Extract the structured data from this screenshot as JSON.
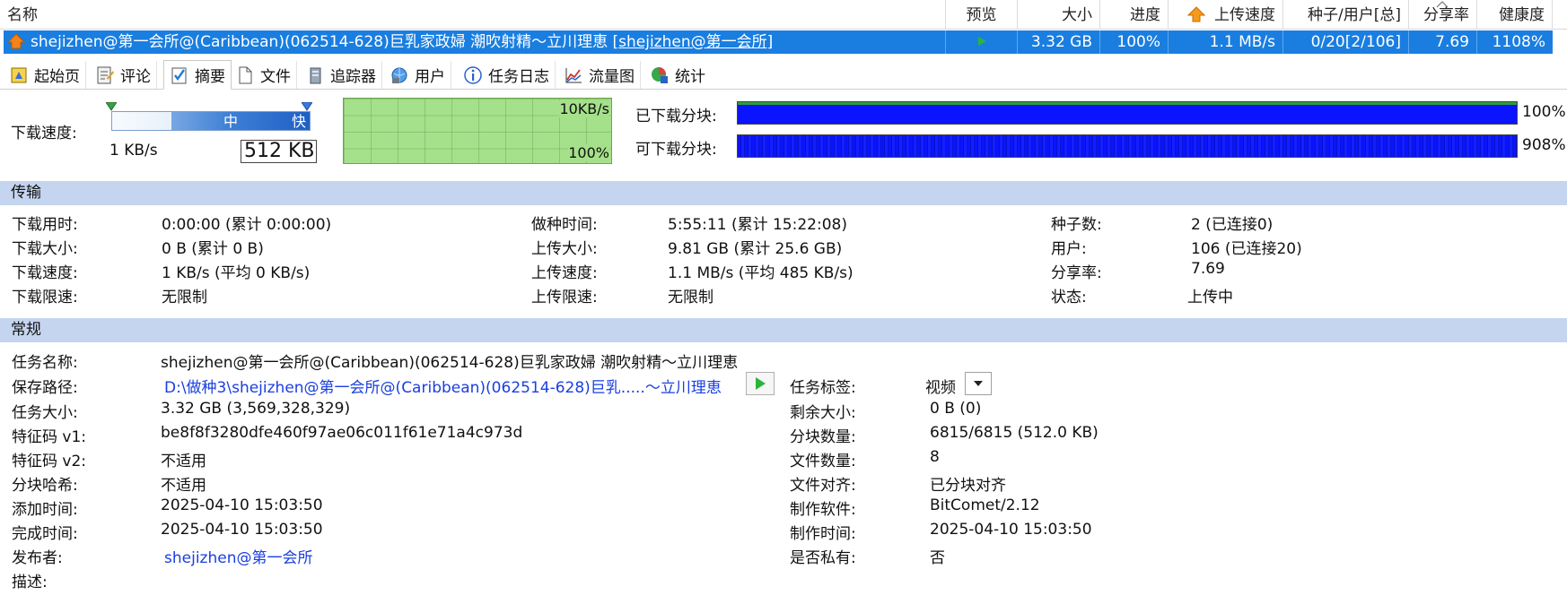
{
  "list": {
    "columns": {
      "name": "名称",
      "preview": "预览",
      "size": "大小",
      "progress": "进度",
      "upload_speed": "上传速度",
      "seeds_peers": "种子/用户[总]",
      "ratio": "分享率",
      "health": "健康度"
    },
    "row": {
      "name_prefix": "shejizhen@第一会所@(Caribbean)(062514-628)巨乳家政婦 潮吹射精～立川理恵 ",
      "name_link": "[shejizhen@第一会所]",
      "size": "3.32 GB",
      "progress": "100%",
      "upload_speed": "1.1 MB/s",
      "seeds_peers": "0/20[2/106]",
      "ratio": "7.69",
      "health": "1108%"
    }
  },
  "tabs": [
    {
      "label": "起始页",
      "icon": "start-page-icon"
    },
    {
      "label": "评论",
      "icon": "comment-icon"
    },
    {
      "label": "摘要",
      "icon": "summary-icon"
    },
    {
      "label": "文件",
      "icon": "file-icon"
    },
    {
      "label": "追踪器",
      "icon": "tracker-icon"
    },
    {
      "label": "用户",
      "icon": "users-icon"
    },
    {
      "label": "任务日志",
      "icon": "info-icon"
    },
    {
      "label": "流量图",
      "icon": "traffic-chart-icon"
    },
    {
      "label": "统计",
      "icon": "statistics-icon"
    }
  ],
  "speed": {
    "label": "下载速度:",
    "slider_mid": "中",
    "slider_fast": "快",
    "min": "1 KB/s",
    "limit_value": "512 KB",
    "graph_top": "10KB/s",
    "graph_bottom": "100%"
  },
  "pieces": {
    "downloaded_label": "已下载分块:",
    "downloaded_pct": "100%",
    "available_label": "可下载分块:",
    "available_pct": "908%"
  },
  "transfer": {
    "title": "传输",
    "col1": [
      {
        "k": "下载用时:",
        "v": "0:00:00 (累计 0:00:00)"
      },
      {
        "k": "下载大小:",
        "v": "0 B (累计 0 B)"
      },
      {
        "k": "下载速度:",
        "v": "1 KB/s (平均 0 KB/s)"
      },
      {
        "k": "下载限速:",
        "v": "无限制"
      }
    ],
    "col2": [
      {
        "k": "做种时间:",
        "v": "5:55:11 (累计 15:22:08)"
      },
      {
        "k": "上传大小:",
        "v": "9.81 GB (累计 25.6 GB)"
      },
      {
        "k": "上传速度:",
        "v": "1.1 MB/s (平均 485 KB/s)"
      },
      {
        "k": "上传限速:",
        "v": "无限制"
      }
    ],
    "col3": [
      {
        "k": "种子数:",
        "v": "2 (已连接0)"
      },
      {
        "k": "用户:",
        "v": "106 (已连接20)"
      },
      {
        "k": "分享率:",
        "v": "7.69"
      },
      {
        "k": "状态:",
        "v": "上传中"
      }
    ]
  },
  "general": {
    "title": "常规",
    "left": [
      {
        "k": "任务名称:",
        "v": "shejizhen@第一会所@(Caribbean)(062514-628)巨乳家政婦 潮吹射精～立川理恵"
      },
      {
        "k": "保存路径:",
        "v": "D:\\做种3\\shejizhen@第一会所@(Caribbean)(062514-628)巨乳.....～立川理恵"
      },
      {
        "k": "任务大小:",
        "v": "3.32 GB (3,569,328,329)"
      },
      {
        "k": "特征码 v1:",
        "v": "be8f8f3280dfe460f97ae06c011f61e71a4c973d"
      },
      {
        "k": "特征码 v2:",
        "v": "不适用"
      },
      {
        "k": "分块哈希:",
        "v": "不适用"
      },
      {
        "k": "添加时间:",
        "v": "2025-04-10 15:03:50"
      },
      {
        "k": "完成时间:",
        "v": "2025-04-10 15:03:50"
      },
      {
        "k": "发布者:",
        "v": "shejizhen@第一会所"
      },
      {
        "k": "描述:",
        "v": ""
      }
    ],
    "right": [
      {
        "k": "任务标签:",
        "v": "视频"
      },
      {
        "k": "剩余大小:",
        "v": "0 B (0)"
      },
      {
        "k": "分块数量:",
        "v": "6815/6815 (512.0 KB)"
      },
      {
        "k": "文件数量:",
        "v": "8"
      },
      {
        "k": "文件对齐:",
        "v": "已分块对齐"
      },
      {
        "k": "制作软件:",
        "v": "BitComet/2.12"
      },
      {
        "k": "制作时间:",
        "v": "2025-04-10 15:03:50"
      },
      {
        "k": "是否私有:",
        "v": "否"
      }
    ]
  },
  "colors": {
    "selection": "#1a7ee0",
    "section_bar": "#c5d5ef",
    "piece_blue": "#0a14ff",
    "graph_green": "#a5e08a",
    "link": "#1a3fe0"
  }
}
